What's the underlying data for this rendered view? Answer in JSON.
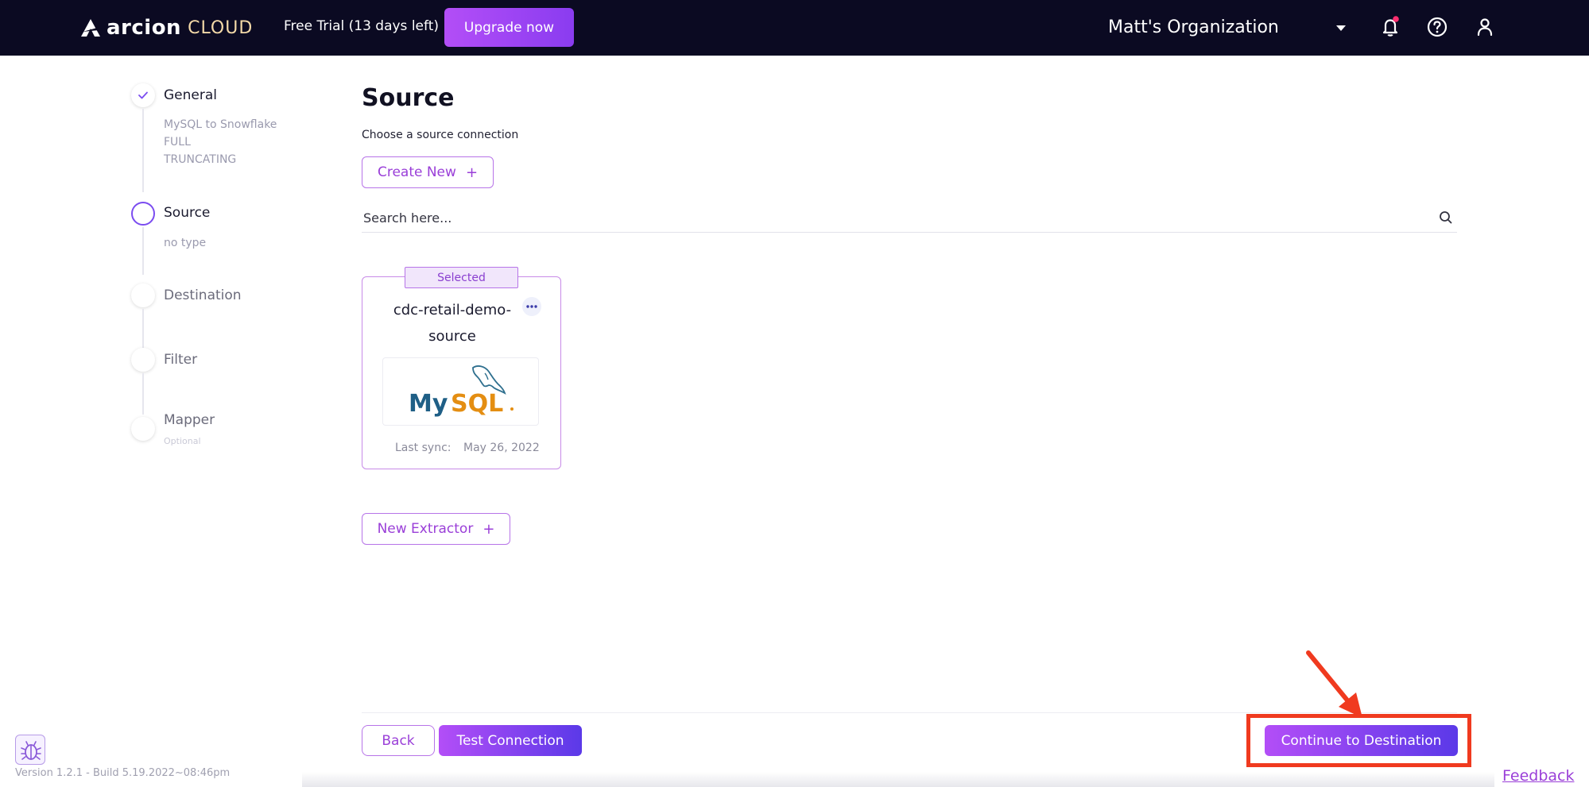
{
  "header": {
    "logo_word": "arcion",
    "logo_cloud": "CLOUD",
    "trial_text": "Free Trial (13 days left)",
    "upgrade_label": "Upgrade now",
    "org_name": "Matt's Organization",
    "icons": [
      "bell-icon",
      "help-icon",
      "user-icon"
    ],
    "notification_dot_color": "#ff2d6f"
  },
  "stepper": {
    "steps": [
      {
        "title": "General",
        "status": "done",
        "sub": [
          "MySQL to Snowflake",
          "FULL",
          "TRUNCATING"
        ]
      },
      {
        "title": "Source",
        "status": "active",
        "sub": [
          "no type"
        ]
      },
      {
        "title": "Destination",
        "status": "pending",
        "sub": []
      },
      {
        "title": "Filter",
        "status": "pending",
        "sub": []
      },
      {
        "title": "Mapper",
        "status": "pending",
        "optional": "Optional"
      }
    ]
  },
  "main": {
    "title": "Source",
    "subtitle": "Choose a source connection",
    "create_new_label": "Create New",
    "search_placeholder": "Search here...",
    "card": {
      "selected_label": "Selected",
      "name": "cdc-retail-demo-source",
      "logo": "MySQL",
      "sync_label": "Last sync:",
      "sync_date": "May 26, 2022"
    },
    "new_extractor_label": "New Extractor"
  },
  "footer": {
    "back_label": "Back",
    "test_label": "Test Connection",
    "continue_label": "Continue to Destination",
    "version": "Version 1.2.1 - Build 5.19.2022~08:46pm",
    "feedback": "Feedback",
    "accent_color": "#9a3fd8",
    "annotation_color": "#f03a1f"
  }
}
